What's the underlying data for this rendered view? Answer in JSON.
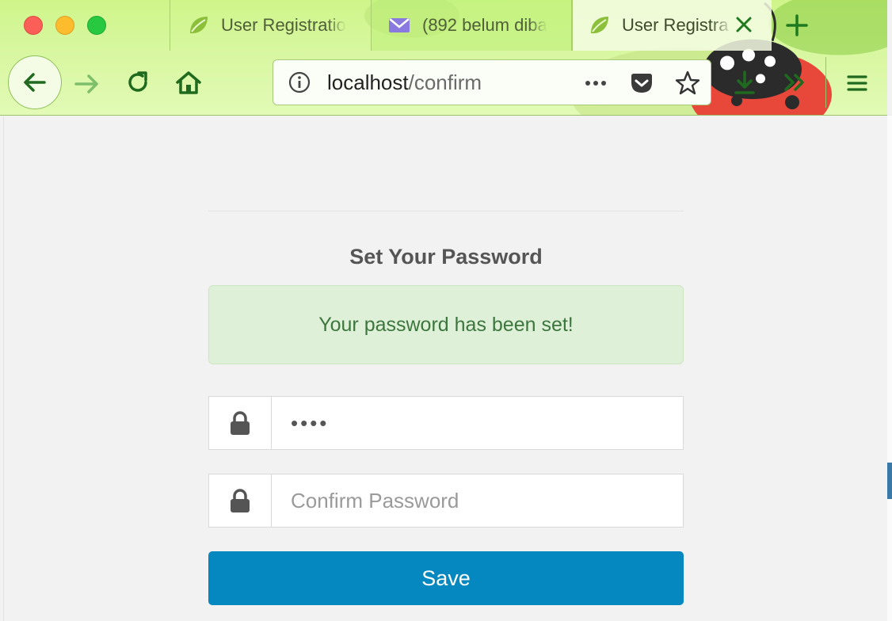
{
  "browser": {
    "tabs": [
      {
        "label": "User Registratio",
        "favicon": "spring-leaf-icon",
        "active": false
      },
      {
        "label": "(892 belum diba",
        "favicon": "envelope-icon",
        "active": false
      },
      {
        "label": "User Registra",
        "favicon": "spring-leaf-icon",
        "active": true
      }
    ],
    "url": {
      "host": "localhost",
      "path": "/confirm"
    },
    "toolbar_icons": [
      "back-arrow-icon",
      "forward-arrow-icon",
      "reload-icon",
      "home-icon",
      "info-icon",
      "more-icon",
      "pocket-icon",
      "star-icon",
      "download-icon",
      "overflow-icon",
      "menu-icon"
    ],
    "accent_color": "#1f7a1f"
  },
  "form": {
    "title": "Set Your Password",
    "alert_message": "Your password has been set!",
    "password_value": "••••",
    "confirm_placeholder": "Confirm Password",
    "save_label": "Save",
    "colors": {
      "alert_bg": "#dff0d8",
      "alert_text": "#3c763d",
      "button_bg": "#0588bf"
    }
  }
}
